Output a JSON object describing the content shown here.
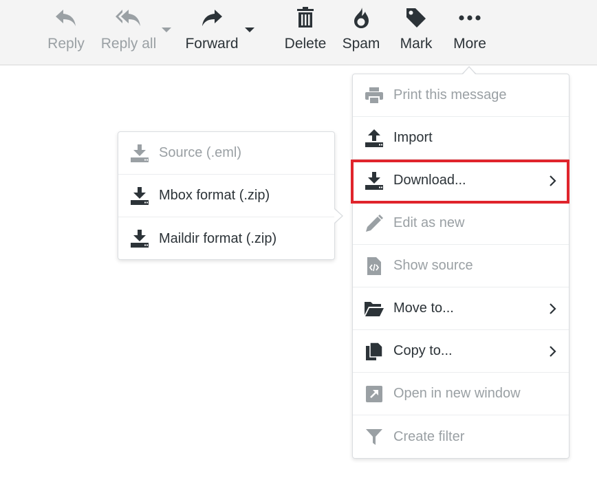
{
  "colors": {
    "enabled": "#2c3338",
    "disabled": "#9aa0a4",
    "highlight": "#e0242c",
    "toolbar_bg": "#f4f4f4"
  },
  "toolbar": {
    "reply": {
      "label": "Reply",
      "icon": "reply-icon",
      "enabled": false
    },
    "reply_all": {
      "label": "Reply all",
      "icon": "reply-all-icon",
      "enabled": false
    },
    "forward": {
      "label": "Forward",
      "icon": "forward-icon",
      "enabled": true
    },
    "delete": {
      "label": "Delete",
      "icon": "trash-icon",
      "enabled": true
    },
    "spam": {
      "label": "Spam",
      "icon": "fire-icon",
      "enabled": true
    },
    "mark": {
      "label": "Mark",
      "icon": "tag-icon",
      "enabled": true
    },
    "more": {
      "label": "More",
      "icon": "ellipsis-icon",
      "enabled": true
    }
  },
  "more_menu": {
    "items": [
      {
        "label": "Print this message",
        "icon": "printer-icon",
        "enabled": false,
        "submenu": false
      },
      {
        "label": "Import",
        "icon": "upload-icon",
        "enabled": true,
        "submenu": false
      },
      {
        "label": "Download...",
        "icon": "download-icon",
        "enabled": true,
        "submenu": true,
        "highlighted": true
      },
      {
        "label": "Edit as new",
        "icon": "pencil-icon",
        "enabled": false,
        "submenu": false
      },
      {
        "label": "Show source",
        "icon": "code-file-icon",
        "enabled": false,
        "submenu": false
      },
      {
        "label": "Move to...",
        "icon": "folder-open-icon",
        "enabled": true,
        "submenu": true
      },
      {
        "label": "Copy to...",
        "icon": "copy-icon",
        "enabled": true,
        "submenu": true
      },
      {
        "label": "Open in new window",
        "icon": "external-window-icon",
        "enabled": false,
        "submenu": false
      },
      {
        "label": "Create filter",
        "icon": "filter-icon",
        "enabled": false,
        "submenu": false
      }
    ]
  },
  "download_menu": {
    "items": [
      {
        "label": "Source (.eml)",
        "icon": "download-icon",
        "enabled": false
      },
      {
        "label": "Mbox format (.zip)",
        "icon": "download-icon",
        "enabled": true
      },
      {
        "label": "Maildir format (.zip)",
        "icon": "download-icon",
        "enabled": true
      }
    ]
  }
}
